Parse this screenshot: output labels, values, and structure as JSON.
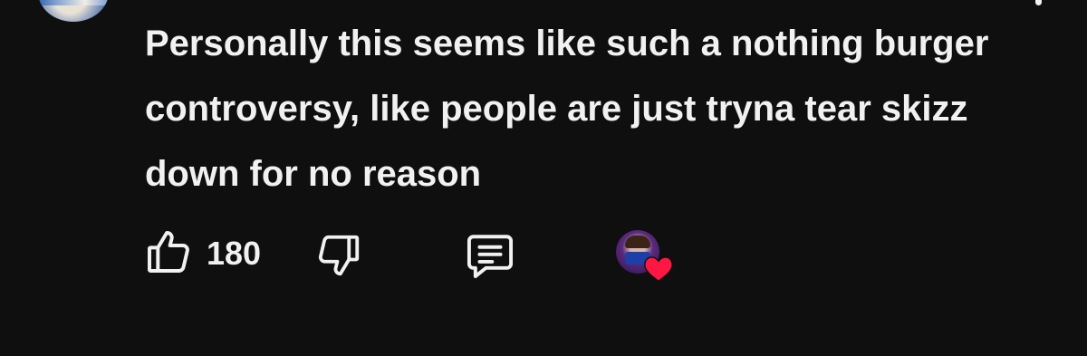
{
  "comment": {
    "text": "Personally this seems like such a nothing burger controversy, like people are just tryna tear skizz down for no reason"
  },
  "actions": {
    "like_count": "180",
    "like_icon": "thumbs-up-icon",
    "dislike_icon": "thumbs-down-icon",
    "reply_icon": "comment-bubble-icon",
    "creator_heart_icon": "heart-icon"
  },
  "colors": {
    "background": "#0f0f0f",
    "text": "#f1f1f1",
    "heart": "#ff1744"
  }
}
